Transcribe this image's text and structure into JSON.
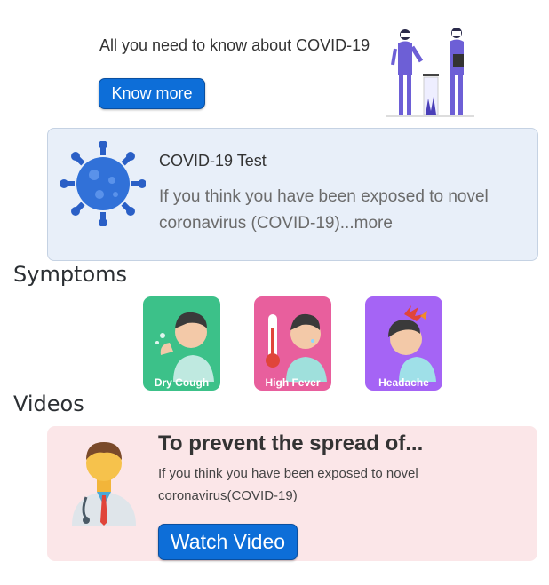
{
  "hero": {
    "title": "All you need to know about COVID-19",
    "button_label": "Know more",
    "illustration_icon": "doctors-with-test-sample-icon"
  },
  "test_card": {
    "icon": "coronavirus-icon",
    "title": "COVID-19 Test",
    "description": "If you think you have been exposed to novel coronavirus (COVID-19)...more"
  },
  "symptoms": {
    "title": "Symptoms",
    "items": [
      {
        "label": "Dry Cough",
        "icon": "dry-cough-icon",
        "color": "#3cc189"
      },
      {
        "label": "High Fever",
        "icon": "high-fever-icon",
        "color": "#e85f9d"
      },
      {
        "label": "Headache",
        "icon": "headache-icon",
        "color": "#a564f5"
      }
    ]
  },
  "videos": {
    "title": "Videos",
    "card": {
      "icon": "doctor-icon",
      "title": "To prevent the spread of...",
      "description": "If you think you have been exposed to novel coronavirus(COVID-19)",
      "button_label": "Watch Video"
    }
  },
  "colors": {
    "primary": "#0d6ed8",
    "test_card_bg": "#e8eff9",
    "video_card_bg": "#fbe6e8"
  }
}
